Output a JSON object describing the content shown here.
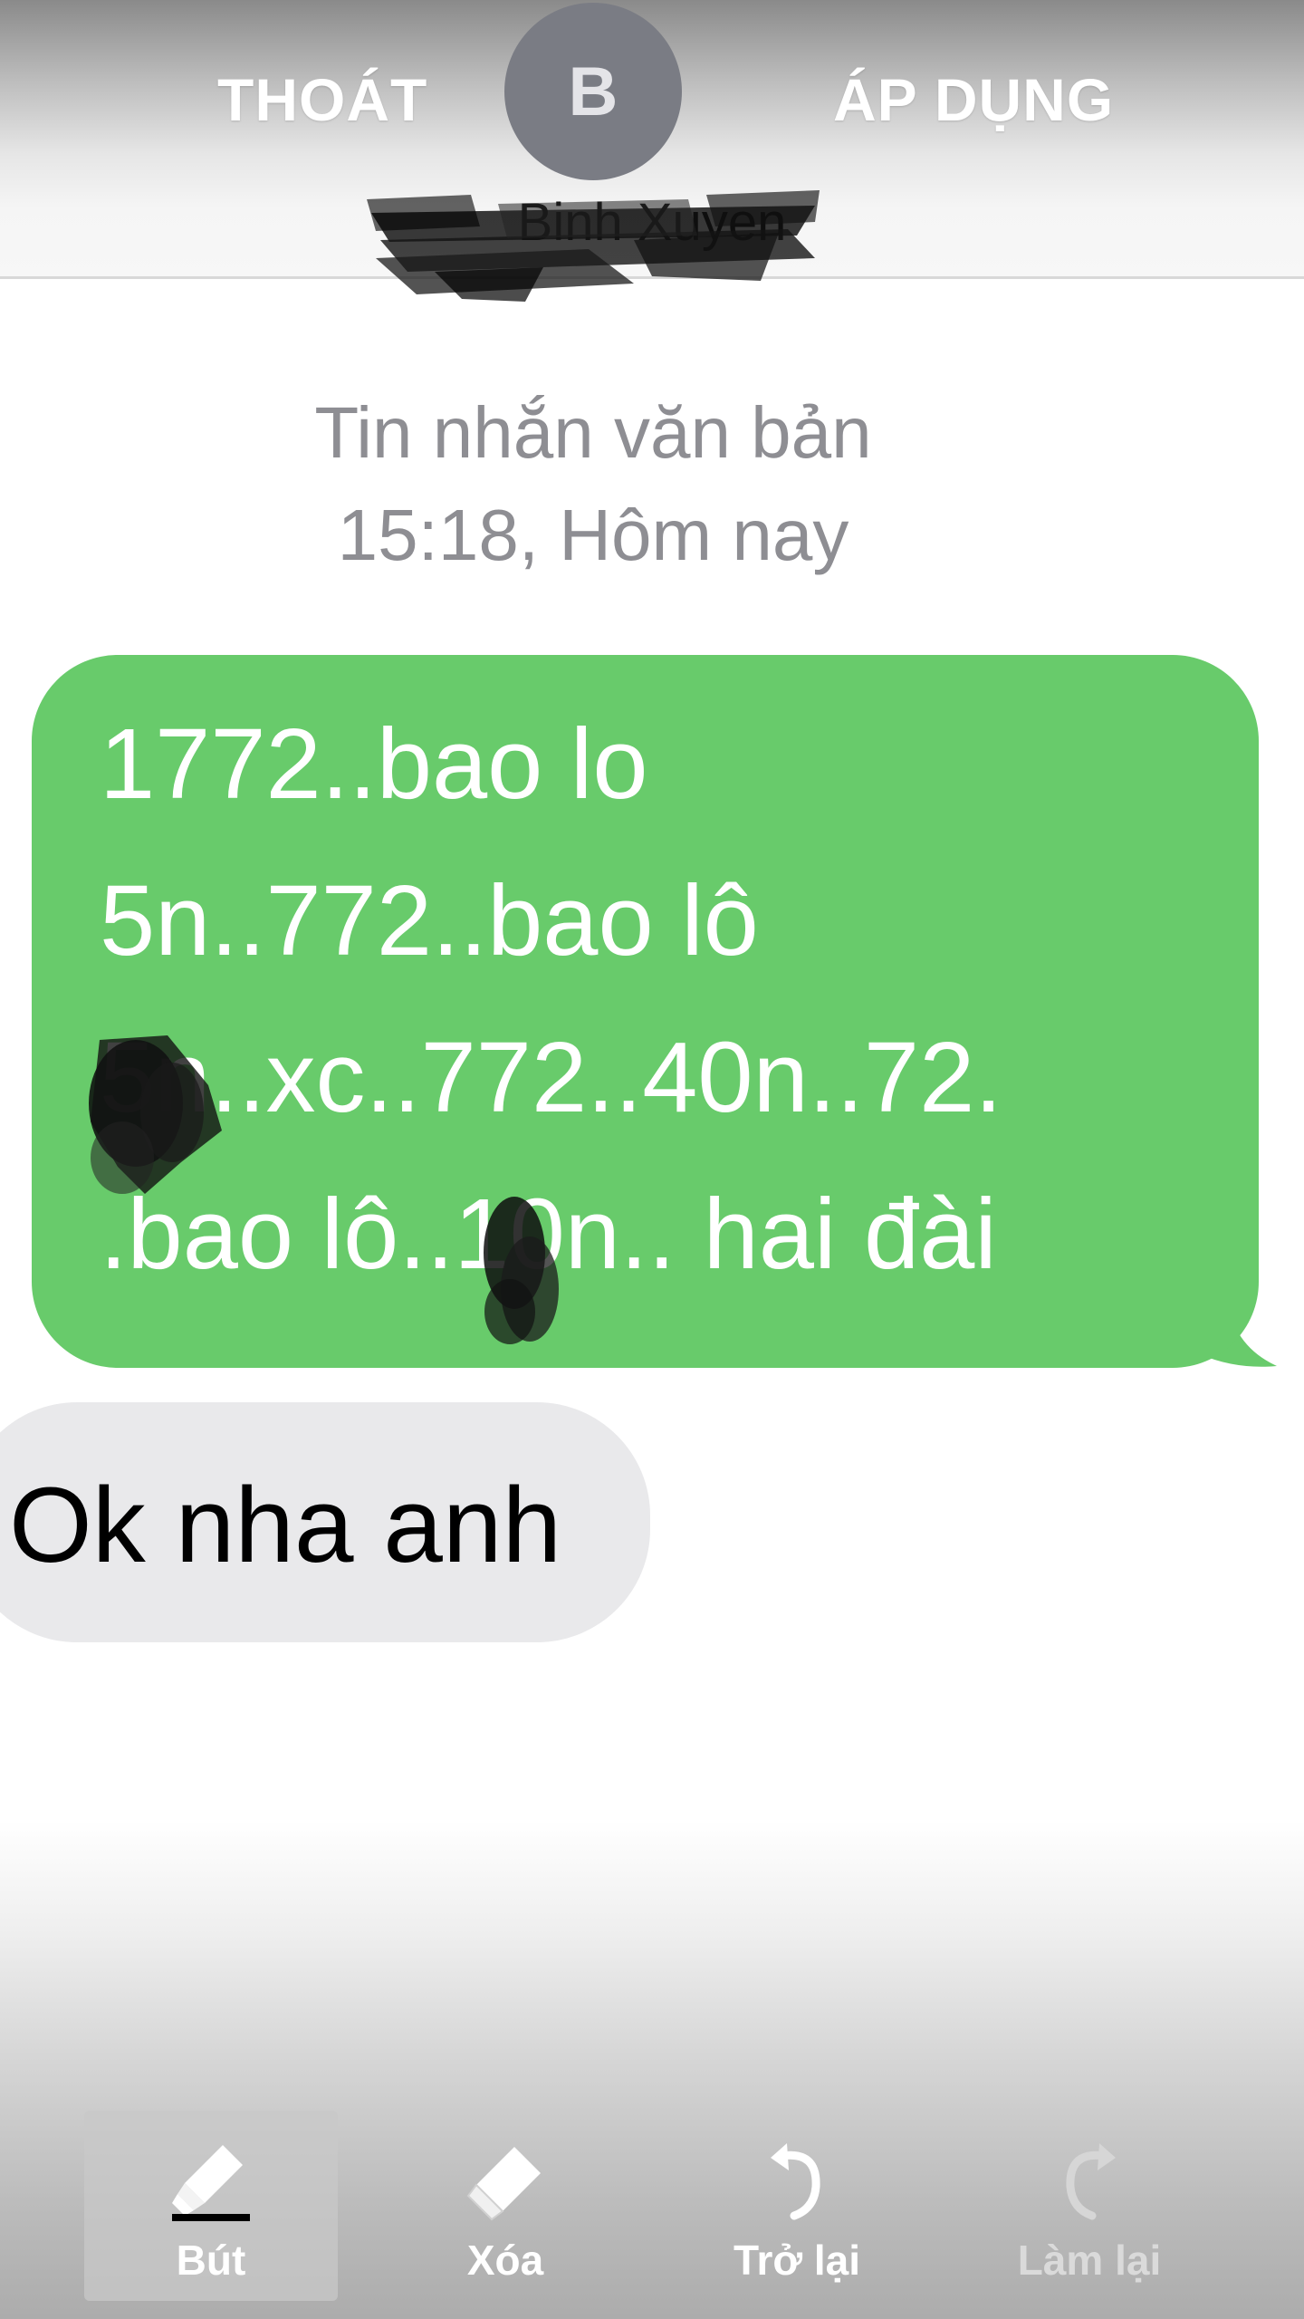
{
  "header": {
    "exit_label": "THOÁT",
    "apply_label": "ÁP DỤNG",
    "avatar_initial": "B",
    "contact_name": "Binh Xuyen"
  },
  "conversation": {
    "message_type": "Tin nhắn văn bản",
    "timestamp": "15:18, Hôm nay",
    "sent_message": {
      "lines": [
        "1772..bao lo",
        "5n..772..bao lô",
        "5n..xc..772..40n..72.",
        ".bao lô..10n.. hai đài"
      ],
      "color": "#68cb6b"
    },
    "received_message": {
      "text": "Ok nha anh",
      "color": "#e9e9eb"
    }
  },
  "toolbar": {
    "pen_label": "Bút",
    "eraser_label": "Xóa",
    "undo_label": "Trở lại",
    "redo_label": "Làm lại"
  },
  "colors": {
    "ink": "#000000",
    "sent_bubble": "#68cb6b",
    "received_bubble": "#e9e9eb",
    "meta_text": "#8e8e93"
  },
  "icons": {
    "pen": "highlighter-pen-icon",
    "eraser": "eraser-icon",
    "undo": "undo-arrow-icon",
    "redo": "redo-arrow-icon"
  }
}
